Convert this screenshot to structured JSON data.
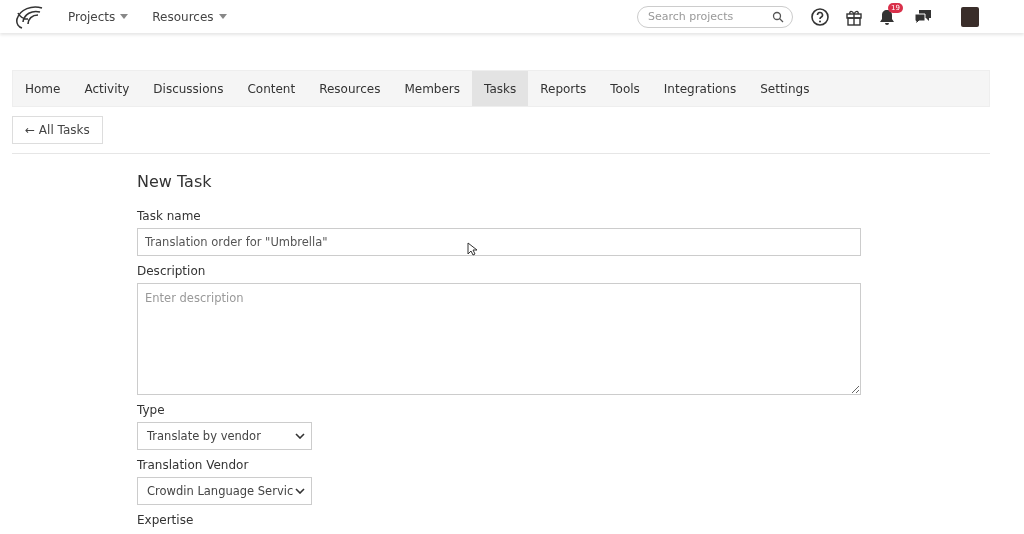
{
  "topbar": {
    "menus": [
      {
        "label": "Projects"
      },
      {
        "label": "Resources"
      }
    ],
    "search": {
      "placeholder": "Search projects"
    },
    "notifications_count": "19"
  },
  "tabs": [
    {
      "label": "Home",
      "selected": false
    },
    {
      "label": "Activity",
      "selected": false
    },
    {
      "label": "Discussions",
      "selected": false
    },
    {
      "label": "Content",
      "selected": false
    },
    {
      "label": "Resources",
      "selected": false
    },
    {
      "label": "Members",
      "selected": false
    },
    {
      "label": "Tasks",
      "selected": true
    },
    {
      "label": "Reports",
      "selected": false
    },
    {
      "label": "Tools",
      "selected": false
    },
    {
      "label": "Integrations",
      "selected": false
    },
    {
      "label": "Settings",
      "selected": false
    }
  ],
  "back_button": "← All Tasks",
  "form": {
    "title": "New Task",
    "fields": [
      {
        "kind": "text",
        "label": "Task name",
        "value": "Translation order for \"Umbrella\""
      },
      {
        "kind": "textarea",
        "label": "Description",
        "placeholder": "Enter description"
      },
      {
        "kind": "select",
        "label": "Type",
        "value": "Translate by vendor"
      },
      {
        "kind": "select",
        "label": "Translation Vendor",
        "value": "Crowdin Language Servic"
      },
      {
        "kind": "label",
        "label": "Expertise"
      }
    ]
  }
}
